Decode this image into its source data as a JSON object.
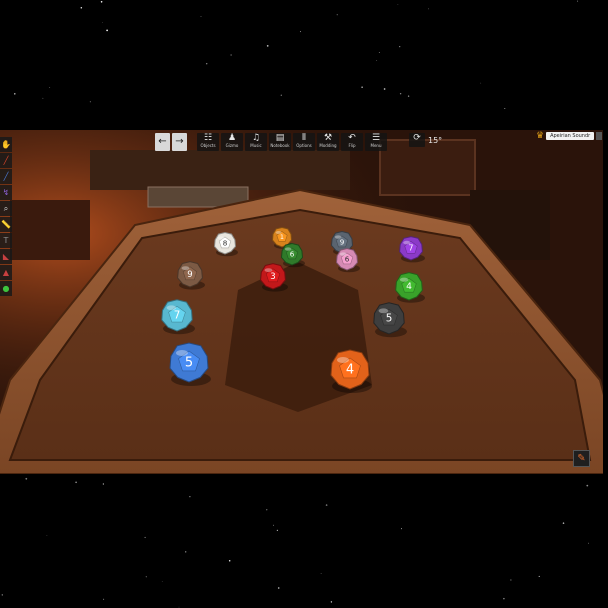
{
  "toolbar": {
    "back_icon": "arrow-left-icon",
    "forward_icon": "arrow-right-icon",
    "items": [
      {
        "name": "objects-button",
        "icon": "objects-icon",
        "glyph": "☷",
        "label": "Objects"
      },
      {
        "name": "gizmo-button",
        "icon": "gizmo-icon",
        "glyph": "♟",
        "label": "Gizmo"
      },
      {
        "name": "music-button",
        "icon": "speaker-icon",
        "glyph": "♫",
        "label": "Music"
      },
      {
        "name": "notebook-button",
        "icon": "notebook-icon",
        "glyph": "▤",
        "label": "Notebook"
      },
      {
        "name": "options-button",
        "icon": "options-icon",
        "glyph": "⦀",
        "label": "Options"
      },
      {
        "name": "modding-button",
        "icon": "hammer-wrench-icon",
        "glyph": "⚒",
        "label": "Modding"
      },
      {
        "name": "flip-button",
        "icon": "flip-icon",
        "glyph": "↶",
        "label": "Flip"
      },
      {
        "name": "menu-button",
        "icon": "menu-icon",
        "glyph": "☰",
        "label": "Menu"
      }
    ]
  },
  "rotation": {
    "icon": "rotate-icon",
    "value": "15°"
  },
  "player": {
    "name": "Apeirian Soundr",
    "crown_icon": "crown-icon"
  },
  "left_tools": [
    {
      "name": "grab-tool",
      "icon": "hand-icon",
      "color": "#f08a2a"
    },
    {
      "name": "pen-tool",
      "icon": "pen-icon",
      "color": "#d8442a"
    },
    {
      "name": "line-tool",
      "icon": "line-icon",
      "color": "#4b7bd6"
    },
    {
      "name": "flick-tool",
      "icon": "flick-icon",
      "color": "#8a5fd0"
    },
    {
      "name": "zoom-tool",
      "icon": "zoom-icon",
      "color": "#dddddd"
    },
    {
      "name": "ruler-tool",
      "icon": "ruler-icon",
      "color": "#9a9a9a"
    },
    {
      "name": "text-tool",
      "icon": "text-icon",
      "color": "#8c8c8c"
    },
    {
      "name": "snap-tool",
      "icon": "snap-icon",
      "color": "#c84040"
    },
    {
      "name": "hidden-zone-tool",
      "icon": "zone-icon",
      "color": "#c84040"
    },
    {
      "name": "color-tool",
      "icon": "color-icon",
      "color": "#3ec33e"
    }
  ],
  "dice": [
    {
      "name": "white-die",
      "color": "#e8e5dd",
      "digit": "8"
    },
    {
      "name": "orange-die-small",
      "color": "#d8821c",
      "digit": "1"
    },
    {
      "name": "gray-die",
      "color": "#5a6470",
      "digit": "9"
    },
    {
      "name": "purple-die",
      "color": "#8b3ac8",
      "digit": "7"
    },
    {
      "name": "brown-die",
      "color": "#7c5a44",
      "digit": "9"
    },
    {
      "name": "green-die-small",
      "color": "#2f7a2a",
      "digit": "6"
    },
    {
      "name": "red-die",
      "color": "#c2181a",
      "digit": "3"
    },
    {
      "name": "pink-die",
      "color": "#d68ab4",
      "digit": "6"
    },
    {
      "name": "green-die",
      "color": "#39a22a",
      "digit": "4"
    },
    {
      "name": "cyan-die",
      "color": "#58b8d0",
      "digit": "7"
    },
    {
      "name": "black-die",
      "color": "#3e3e3e",
      "digit": "5"
    },
    {
      "name": "blue-die",
      "color": "#3f7ad4",
      "digit": "5"
    },
    {
      "name": "orange-die",
      "color": "#e2621a",
      "digit": "4"
    }
  ],
  "edit_button_icon": "pencil-icon"
}
